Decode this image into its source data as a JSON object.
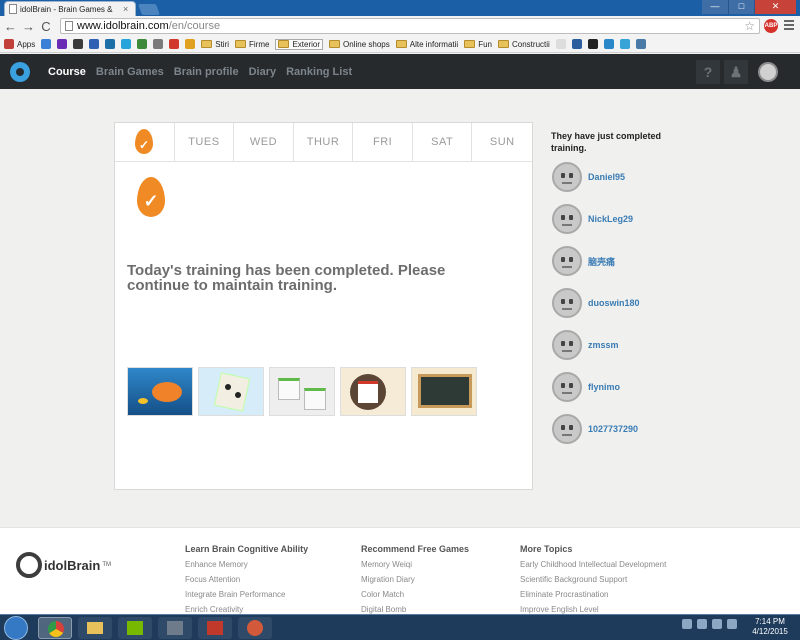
{
  "browser": {
    "tab_title": "idolBrain - Brain Games &",
    "tab_close": "×",
    "window_controls": {
      "minimize": "—",
      "maximize": "□",
      "close": "✕"
    },
    "nav": {
      "back": "←",
      "forward": "→",
      "reload": "C"
    },
    "url_host": "www.idolbrain.com",
    "url_path": "/en/course",
    "star": "☆",
    "abp_label": "ABP",
    "bookmarks": [
      {
        "label": "Apps",
        "type": "apps",
        "color": "#c2403a"
      },
      {
        "label": "",
        "type": "site",
        "color": "#3c7fd6"
      },
      {
        "label": "",
        "type": "site",
        "color": "#6a2bb5"
      },
      {
        "label": "",
        "type": "site",
        "color": "#3b3b3b"
      },
      {
        "label": "",
        "type": "site",
        "color": "#2d5fb5"
      },
      {
        "label": "",
        "type": "site",
        "color": "#1d6fa8"
      },
      {
        "label": "",
        "type": "site",
        "color": "#28a4dc"
      },
      {
        "label": "",
        "type": "site",
        "color": "#3f8a3a"
      },
      {
        "label": "",
        "type": "site",
        "color": "#7a7a7a"
      },
      {
        "label": "",
        "type": "site",
        "color": "#d0392b"
      },
      {
        "label": "",
        "type": "site",
        "color": "#e0a020"
      },
      {
        "label": "Stiri",
        "type": "folder"
      },
      {
        "label": "Firme",
        "type": "folder"
      },
      {
        "label": "Exterior",
        "type": "folder",
        "active": true
      },
      {
        "label": "Online shops",
        "type": "folder"
      },
      {
        "label": "Alte informatii",
        "type": "folder"
      },
      {
        "label": "Fun",
        "type": "folder"
      },
      {
        "label": "Constructii",
        "type": "folder"
      },
      {
        "label": "",
        "type": "site",
        "color": "#dddddd"
      },
      {
        "label": "",
        "type": "site",
        "color": "#2c5e9e"
      },
      {
        "label": "",
        "type": "site",
        "color": "#222222"
      },
      {
        "label": "",
        "type": "site",
        "color": "#2a88c9"
      },
      {
        "label": "",
        "type": "site",
        "color": "#38a3d6"
      },
      {
        "label": "",
        "type": "site",
        "color": "#4a7ba6"
      }
    ]
  },
  "site": {
    "nav": [
      "Course",
      "Brain Games",
      "Brain profile",
      "Diary",
      "Ranking List"
    ],
    "current_nav": "Course",
    "help_label": "?",
    "bell_label": "♟"
  },
  "main": {
    "days": [
      {
        "label": "",
        "completed": true
      },
      {
        "label": "TUES",
        "completed": false
      },
      {
        "label": "WED",
        "completed": false
      },
      {
        "label": "THUR",
        "completed": false
      },
      {
        "label": "FRI",
        "completed": false
      },
      {
        "label": "SAT",
        "completed": false
      },
      {
        "label": "SUN",
        "completed": false
      }
    ],
    "check": "✓",
    "completed_message": "Today's training has been completed. Please continue to maintain training.",
    "games": [
      "fish-game",
      "weiqi-game",
      "dice-game",
      "memo-game",
      "blackboard-game"
    ]
  },
  "sidebar": {
    "title": "They have just completed training.",
    "users": [
      "Daniel95",
      "NickLeg29",
      "脑壳痛",
      "duoswin180",
      "zmssm",
      "flynimo",
      "1027737290"
    ]
  },
  "footer": {
    "brand": "idolBrain",
    "trademark": "TM",
    "columns": [
      {
        "title": "Learn Brain Cognitive Ability",
        "items": [
          "Enhance Memory",
          "Focus Attention",
          "Integrate Brain Performance",
          "Enrich Creativity"
        ]
      },
      {
        "title": "Recommend Free Games",
        "items": [
          "Memory Weiqi",
          "Migration Diary",
          "Color Match",
          "Digital Bomb"
        ]
      },
      {
        "title": "More Topics",
        "items": [
          "Early Childhood Intellectual Development",
          "Scientific Background Support",
          "Eliminate Procrastination",
          "Improve English Level"
        ]
      }
    ]
  },
  "taskbar": {
    "time": "7:14 PM",
    "date": "4/12/2015"
  }
}
